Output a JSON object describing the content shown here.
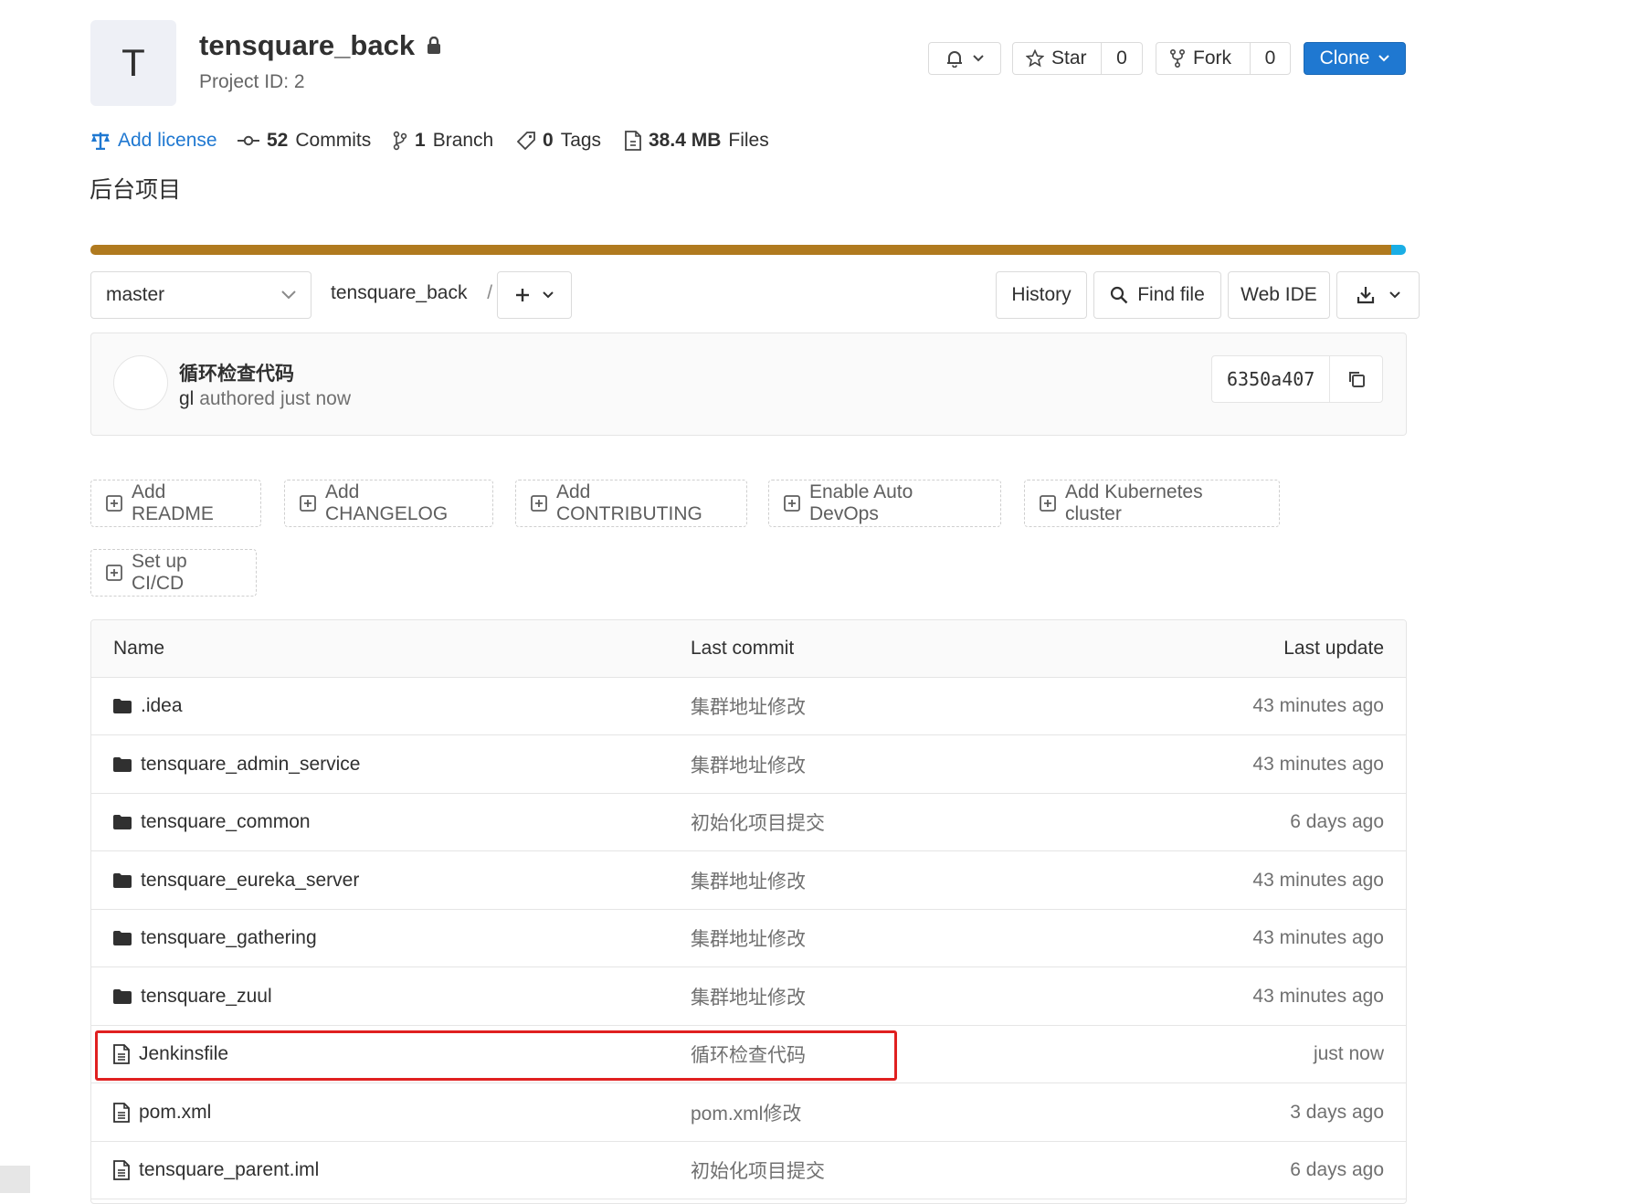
{
  "project": {
    "avatar_letter": "T",
    "name": "tensquare_back",
    "project_id": "Project ID: 2",
    "description": "后台项目"
  },
  "actions": {
    "star_label": "Star",
    "star_count": "0",
    "fork_label": "Fork",
    "fork_count": "0",
    "clone_label": "Clone"
  },
  "stats": {
    "add_license": "Add license",
    "commits_count": "52",
    "commits_label": "Commits",
    "branch_count": "1",
    "branch_label": "Branch",
    "tags_count": "0",
    "tags_label": "Tags",
    "files_size": "38.4 MB",
    "files_label": "Files"
  },
  "language_bar": {
    "colors": [
      "#b07a1f",
      "#1aaee5"
    ],
    "shares": [
      0.989,
      0.011
    ]
  },
  "nav": {
    "branch": "master",
    "path_root": "tensquare_back",
    "path_sep": "/",
    "history": "History",
    "find_file": "Find file",
    "web_ide": "Web IDE"
  },
  "last_commit": {
    "title": "循环检查代码",
    "author": "gl",
    "meta": "authored just now",
    "sha": "6350a407"
  },
  "quick_actions": [
    "Add README",
    "Add CHANGELOG",
    "Add CONTRIBUTING",
    "Enable Auto DevOps",
    "Add Kubernetes cluster",
    "Set up CI/CD"
  ],
  "table": {
    "headers": {
      "name": "Name",
      "last_commit": "Last commit",
      "last_update": "Last update"
    },
    "rows": [
      {
        "type": "folder",
        "name": ".idea",
        "commit": "集群地址修改",
        "update": "43 minutes ago"
      },
      {
        "type": "folder",
        "name": "tensquare_admin_service",
        "commit": "集群地址修改",
        "update": "43 minutes ago"
      },
      {
        "type": "folder",
        "name": "tensquare_common",
        "commit": "初始化项目提交",
        "update": "6 days ago"
      },
      {
        "type": "folder",
        "name": "tensquare_eureka_server",
        "commit": "集群地址修改",
        "update": "43 minutes ago"
      },
      {
        "type": "folder",
        "name": "tensquare_gathering",
        "commit": "集群地址修改",
        "update": "43 minutes ago"
      },
      {
        "type": "folder",
        "name": "tensquare_zuul",
        "commit": "集群地址修改",
        "update": "43 minutes ago"
      },
      {
        "type": "file",
        "name": "Jenkinsfile",
        "commit": "循环检查代码",
        "update": "just now"
      },
      {
        "type": "file",
        "name": "pom.xml",
        "commit": "pom.xml修改",
        "update": "3 days ago"
      },
      {
        "type": "file",
        "name": "tensquare_parent.iml",
        "commit": "初始化项目提交",
        "update": "6 days ago"
      }
    ]
  },
  "colors": {
    "link": "#1f78d1",
    "primary": "#1f78d1",
    "highlight": "#e02020"
  }
}
